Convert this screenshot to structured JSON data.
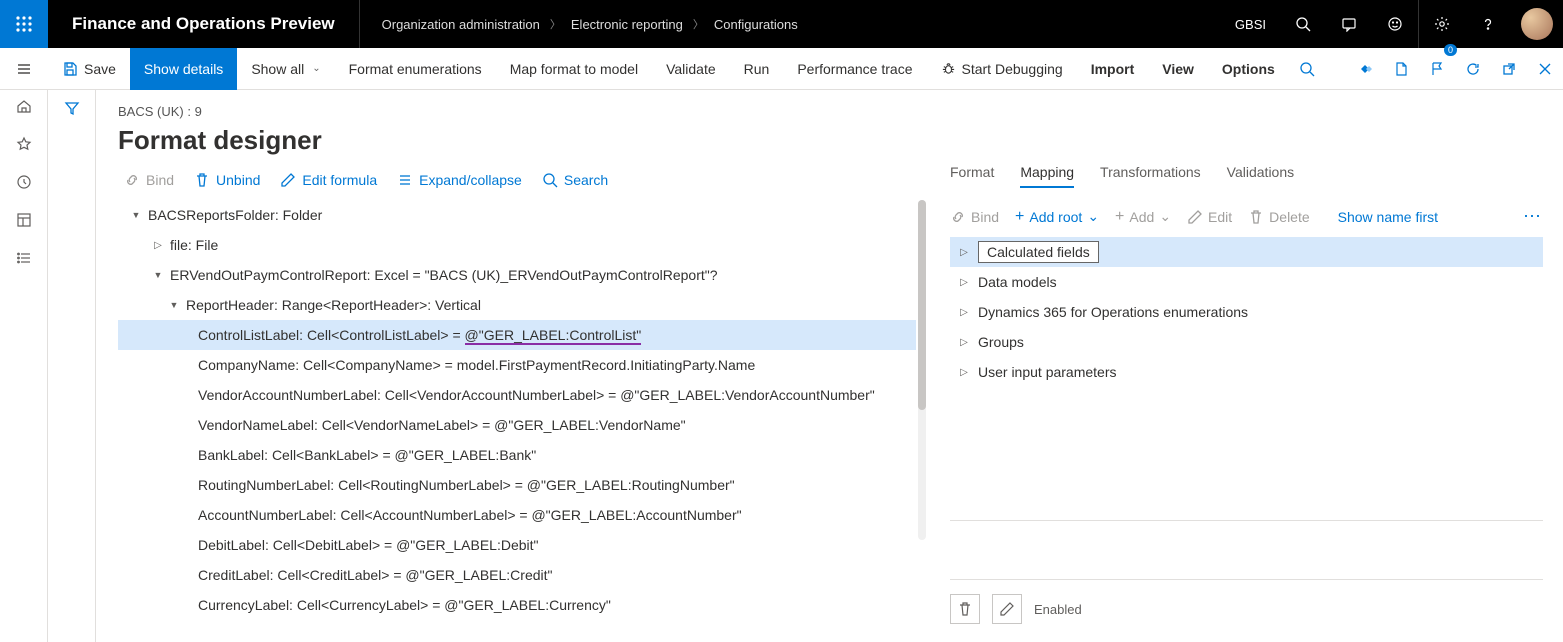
{
  "topbar": {
    "app_title": "Finance and Operations Preview",
    "breadcrumb": [
      "Organization administration",
      "Electronic reporting",
      "Configurations"
    ],
    "company": "GBSI"
  },
  "cmdbar": {
    "save": "Save",
    "show_details": "Show details",
    "show_all": "Show all",
    "format_enum": "Format enumerations",
    "map_format": "Map format to model",
    "validate": "Validate",
    "run": "Run",
    "perf_trace": "Performance trace",
    "start_debug": "Start Debugging",
    "import": "Import",
    "view": "View",
    "options": "Options",
    "notif_badge": "0"
  },
  "page": {
    "breadcrumb_small": "BACS (UK) : 9",
    "title": "Format designer"
  },
  "sub_toolbar": {
    "bind": "Bind",
    "unbind": "Unbind",
    "edit_formula": "Edit formula",
    "expand_collapse": "Expand/collapse",
    "search": "Search"
  },
  "tree": {
    "n0": "BACSReportsFolder: Folder",
    "n1": "file: File",
    "n2": "ERVendOutPaymControlReport: Excel = \"BACS (UK)_ERVendOutPaymControlReport\"?",
    "n3": "ReportHeader: Range<ReportHeader>: Vertical",
    "n4_a": "ControlListLabel: Cell<ControlListLabel> = ",
    "n4_b": "@\"GER_LABEL:ControlList\"",
    "n5": "CompanyName: Cell<CompanyName> = model.FirstPaymentRecord.InitiatingParty.Name",
    "n6": "VendorAccountNumberLabel: Cell<VendorAccountNumberLabel> = @\"GER_LABEL:VendorAccountNumber\"",
    "n7": "VendorNameLabel: Cell<VendorNameLabel> = @\"GER_LABEL:VendorName\"",
    "n8": "BankLabel: Cell<BankLabel> = @\"GER_LABEL:Bank\"",
    "n9": "RoutingNumberLabel: Cell<RoutingNumberLabel> = @\"GER_LABEL:RoutingNumber\"",
    "n10": "AccountNumberLabel: Cell<AccountNumberLabel> = @\"GER_LABEL:AccountNumber\"",
    "n11": "DebitLabel: Cell<DebitLabel> = @\"GER_LABEL:Debit\"",
    "n12": "CreditLabel: Cell<CreditLabel> = @\"GER_LABEL:Credit\"",
    "n13": "CurrencyLabel: Cell<CurrencyLabel> = @\"GER_LABEL:Currency\""
  },
  "right": {
    "tabs": {
      "format": "Format",
      "mapping": "Mapping",
      "transformations": "Transformations",
      "validations": "Validations"
    },
    "toolbar": {
      "bind": "Bind",
      "add_root": "Add root",
      "add": "Add",
      "edit": "Edit",
      "delete": "Delete",
      "show_name_first": "Show name first"
    },
    "tree": {
      "r0": "Calculated fields",
      "r1": "Data models",
      "r2": "Dynamics 365 for Operations enumerations",
      "r3": "Groups",
      "r4": "User input parameters"
    },
    "enabled_label": "Enabled"
  }
}
